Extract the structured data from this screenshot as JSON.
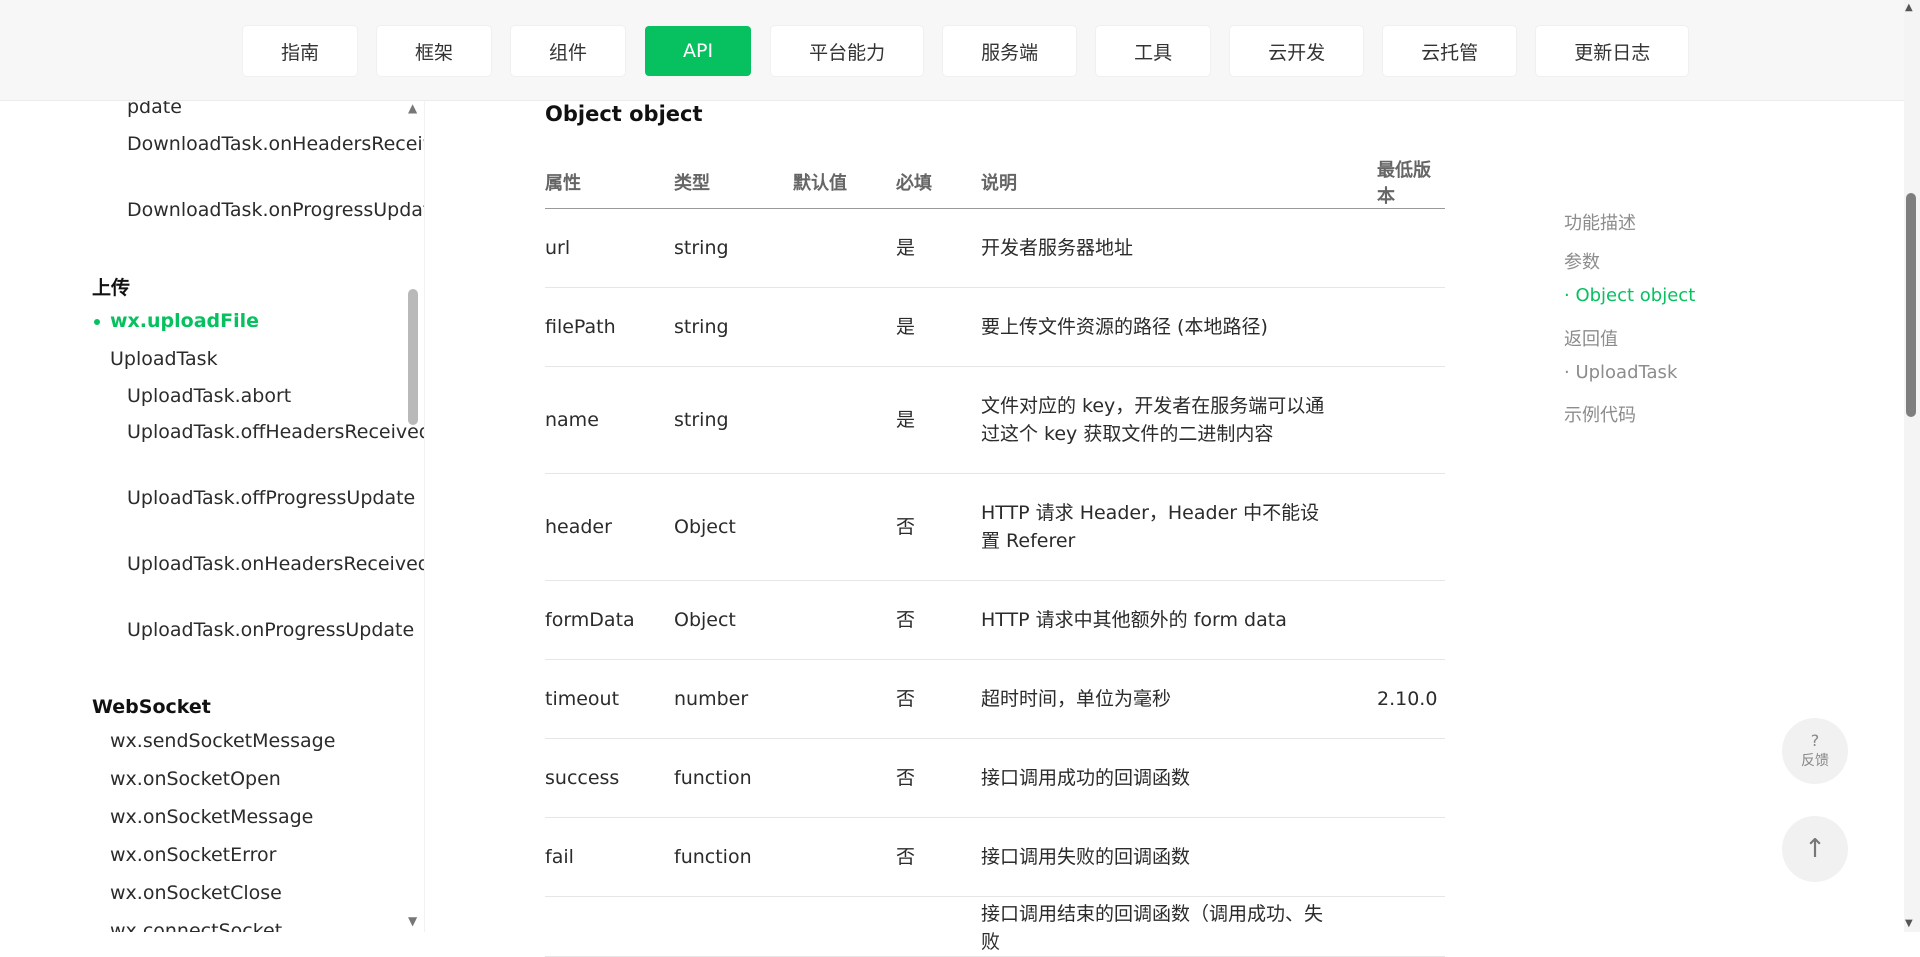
{
  "topnav": {
    "tabs": [
      "指南",
      "框架",
      "组件",
      "API",
      "平台能力",
      "服务端",
      "工具",
      "云开发",
      "云托管",
      "更新日志"
    ],
    "active_tab": "API",
    "accent_color": "#07c160"
  },
  "sidebar": {
    "items": [
      {
        "text": "pdate",
        "level": 3
      },
      {
        "text": "DownloadTask.onHeadersReceived",
        "level": 3
      },
      {
        "text": "DownloadTask.onProgressUpdate",
        "level": 3
      },
      {
        "text": "上传",
        "level": 1
      },
      {
        "text": "wx.uploadFile",
        "level": 2,
        "active": true
      },
      {
        "text": "UploadTask",
        "level": 2
      },
      {
        "text": "UploadTask.abort",
        "level": 3
      },
      {
        "text": "UploadTask.offHeadersReceived",
        "level": 3
      },
      {
        "text": "UploadTask.offProgressUpdate",
        "level": 3
      },
      {
        "text": "UploadTask.onHeadersReceived",
        "level": 3
      },
      {
        "text": "UploadTask.onProgressUpdate",
        "level": 3
      },
      {
        "text": "WebSocket",
        "level": 1
      },
      {
        "text": "wx.sendSocketMessage",
        "level": 2
      },
      {
        "text": "wx.onSocketOpen",
        "level": 2
      },
      {
        "text": "wx.onSocketMessage",
        "level": 2
      },
      {
        "text": "wx.onSocketError",
        "level": 2
      },
      {
        "text": "wx.onSocketClose",
        "level": 2
      },
      {
        "text": "wx.connectSocket",
        "level": 2
      }
    ]
  },
  "main": {
    "section_title": "Object object",
    "table": {
      "headers": [
        "属性",
        "类型",
        "默认值",
        "必填",
        "说明",
        "最低版本"
      ],
      "rows": [
        {
          "attr": "url",
          "type": "string",
          "default": "",
          "required": "是",
          "desc": "开发者服务器地址",
          "version": ""
        },
        {
          "attr": "filePath",
          "type": "string",
          "default": "",
          "required": "是",
          "desc": "要上传文件资源的路径 (本地路径)",
          "version": ""
        },
        {
          "attr": "name",
          "type": "string",
          "default": "",
          "required": "是",
          "desc": "文件对应的 key，开发者在服务端可以通过这个 key 获取文件的二进制内容",
          "version": ""
        },
        {
          "attr": "header",
          "type": "Object",
          "default": "",
          "required": "否",
          "desc": "HTTP 请求 Header，Header 中不能设置 Referer",
          "version": ""
        },
        {
          "attr": "formData",
          "type": "Object",
          "default": "",
          "required": "否",
          "desc": "HTTP 请求中其他额外的 form data",
          "version": ""
        },
        {
          "attr": "timeout",
          "type": "number",
          "default": "",
          "required": "否",
          "desc": "超时时间，单位为毫秒",
          "version": "2.10.0"
        },
        {
          "attr": "success",
          "type": "function",
          "default": "",
          "required": "否",
          "desc": "接口调用成功的回调函数",
          "version": ""
        },
        {
          "attr": "fail",
          "type": "function",
          "default": "",
          "required": "否",
          "desc": "接口调用失败的回调函数",
          "version": ""
        },
        {
          "attr": "",
          "type": "",
          "default": "",
          "required": "",
          "desc": "接口调用结束的回调函数（调用成功、失败",
          "version": ""
        }
      ]
    }
  },
  "toc": {
    "items": [
      {
        "text": "功能描述",
        "active": false
      },
      {
        "text": "参数",
        "active": false
      },
      {
        "text": "· Object object",
        "active": true
      },
      {
        "text": "返回值",
        "active": false
      },
      {
        "text": "· UploadTask",
        "active": false
      },
      {
        "text": "示例代码",
        "active": false
      }
    ]
  },
  "floating": {
    "feedback_symbol": "?",
    "feedback_label": "反馈",
    "back_to_top_icon": "arrow-up-icon"
  }
}
